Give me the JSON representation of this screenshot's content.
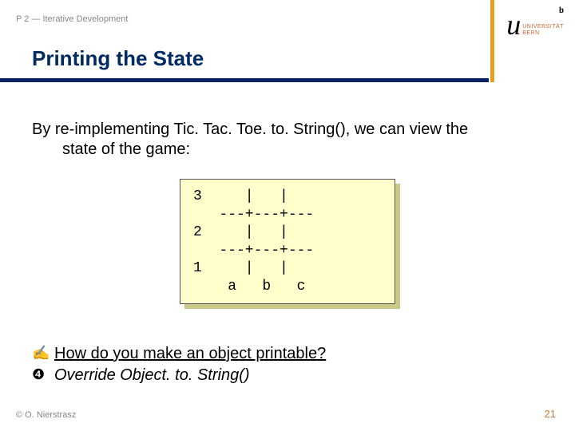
{
  "chapter": "P 2 — Iterative Development",
  "title": "Printing the State",
  "logo": {
    "sup": "b",
    "u": "u",
    "uni_line1": "UNIVERSITÄT",
    "uni_line2": "BERN"
  },
  "para_line1": "By re-implementing Tic. Tac. Toe. to. String(), we can view the",
  "para_line2": "state of the game:",
  "code": "3     |   |   \n   ---+---+---\n2     |   |   \n   ---+---+---\n1     |   |   \n    a   b   c ",
  "question_marker": "✍",
  "answer_marker": "❹",
  "question": "How do you make an object printable?",
  "answer": "Override Object. to. String()",
  "footer_left": "© O. Nierstrasz",
  "footer_right": "21"
}
